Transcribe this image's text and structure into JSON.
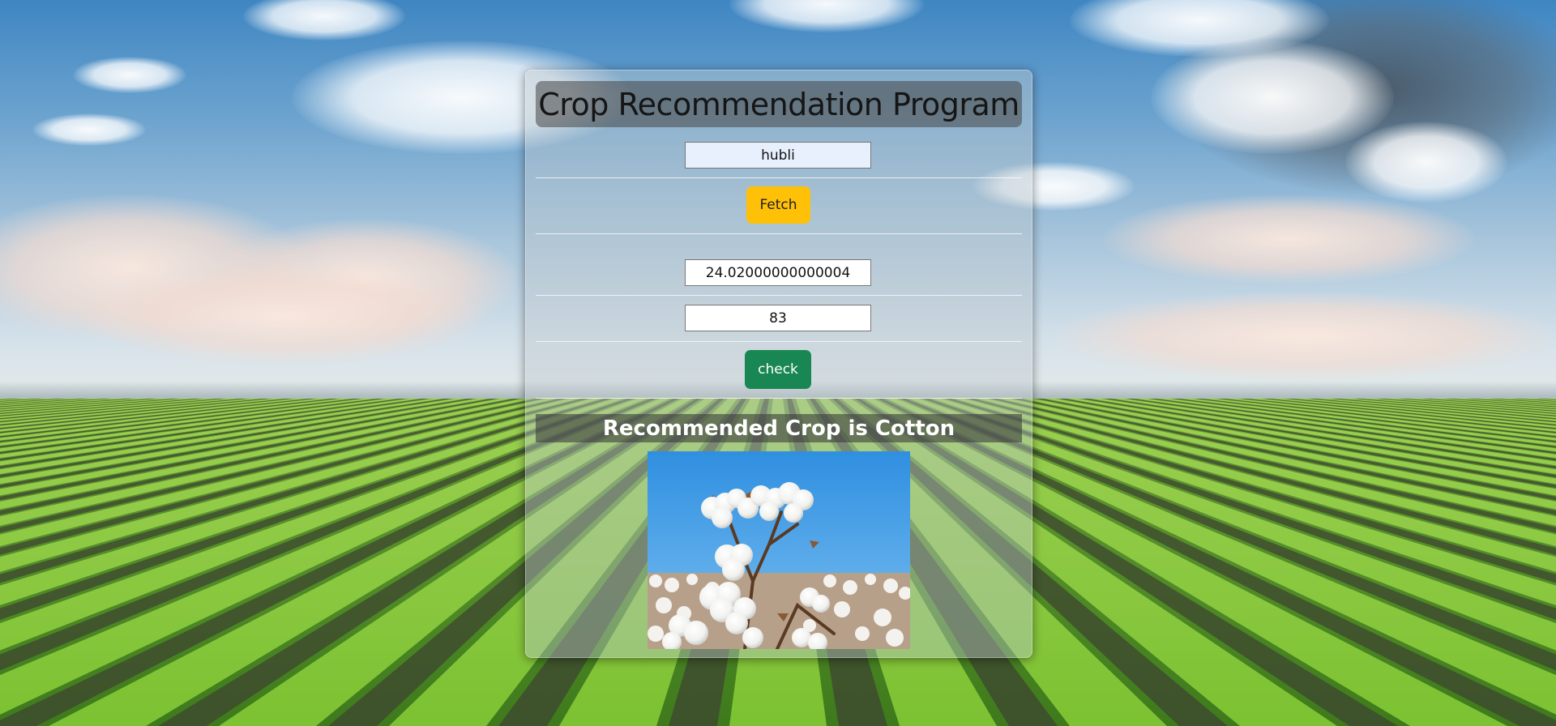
{
  "app": {
    "title": "Crop Recommendation Program"
  },
  "location": {
    "value": "hubli"
  },
  "fetch_button": {
    "label": "Fetch"
  },
  "temperature": {
    "value": "24.02000000000004"
  },
  "humidity": {
    "value": "83"
  },
  "check_button": {
    "label": "check"
  },
  "result": {
    "text": "Recommended Crop is Cotton"
  },
  "colors": {
    "fetch_button": "#ffc107",
    "check_button": "#198754",
    "autofill_field": "#e8f0fe"
  },
  "icons": {
    "crop_image": "cotton-plant-image"
  }
}
